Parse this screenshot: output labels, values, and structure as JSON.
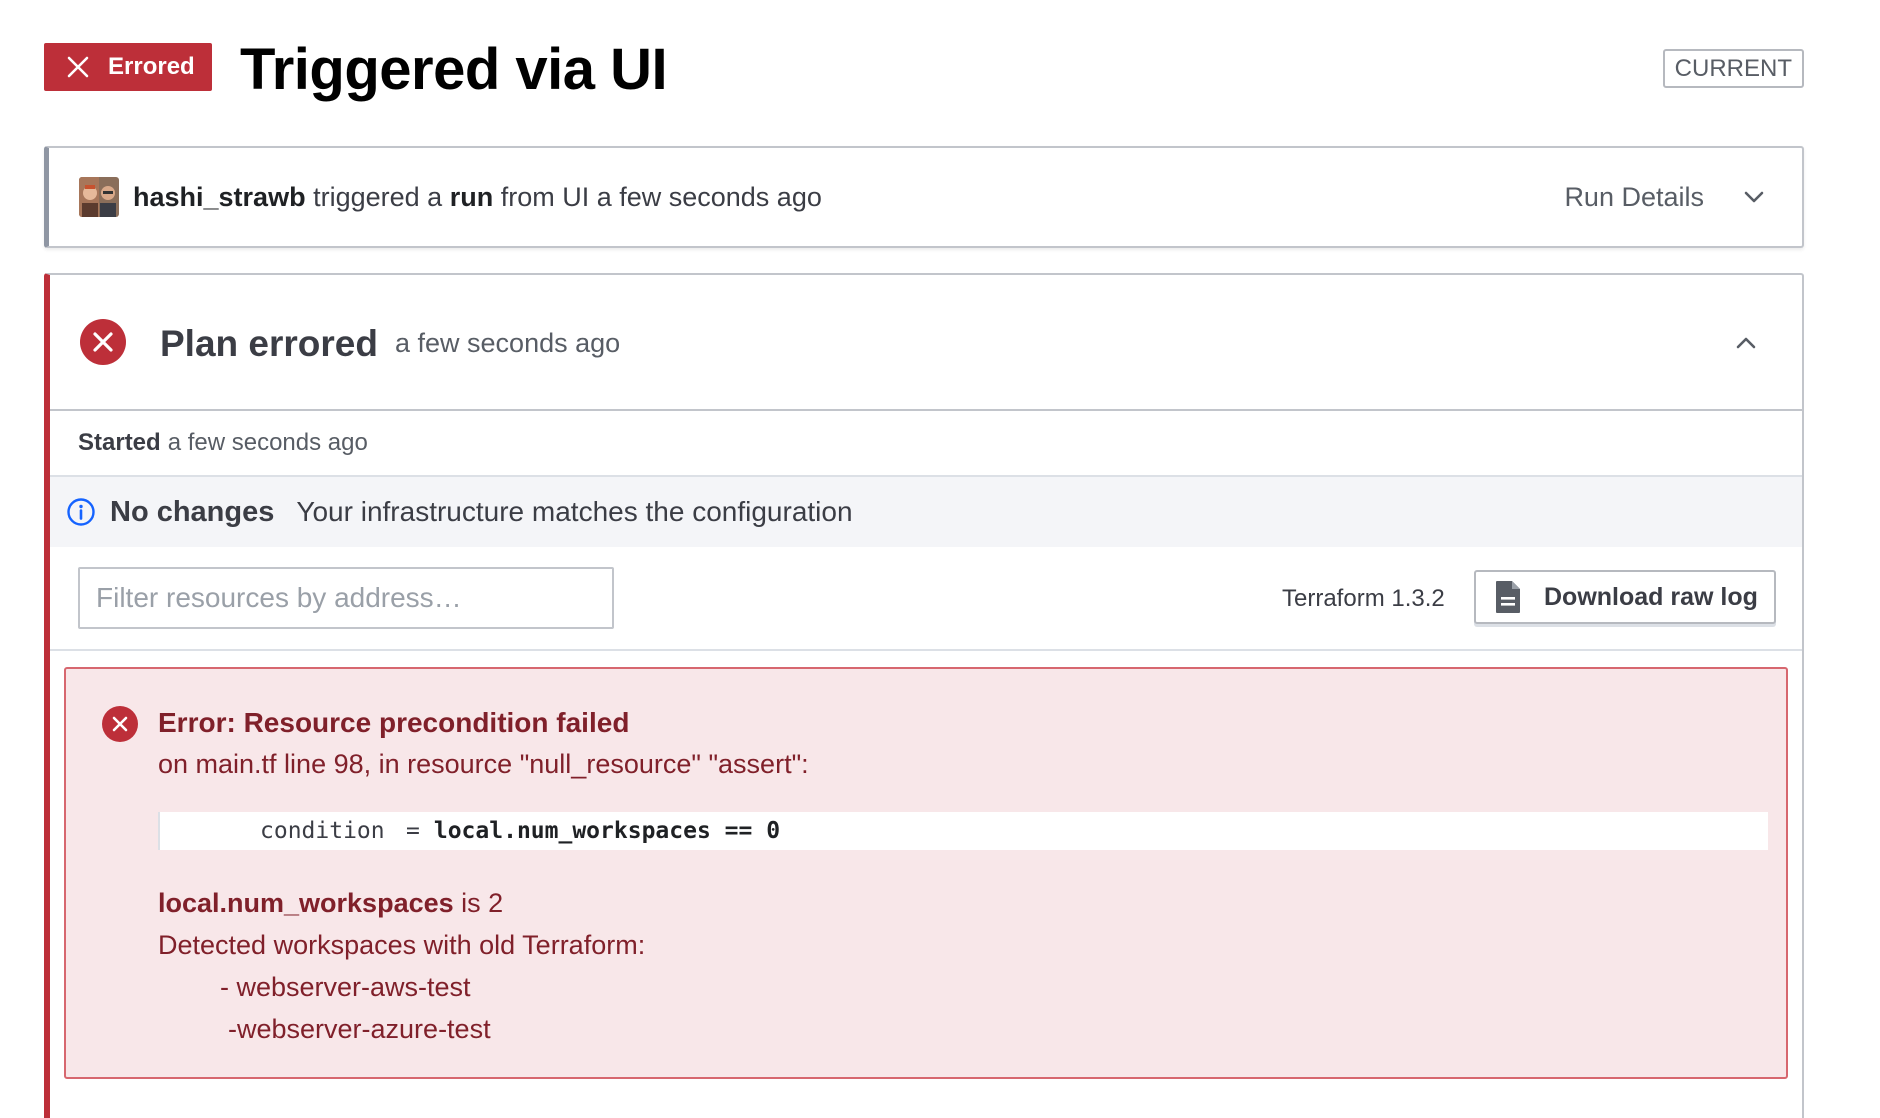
{
  "header": {
    "status_label": "Errored",
    "title": "Triggered via UI",
    "current_badge": "CURRENT"
  },
  "run": {
    "user": "hashi_strawb",
    "text_triggered": "triggered a",
    "text_run": "run",
    "text_from": "from UI a few seconds ago",
    "details_label": "Run Details"
  },
  "plan": {
    "title": "Plan errored",
    "time": "a few seconds ago",
    "started_label": "Started",
    "started_time": "a few seconds ago",
    "no_changes_title": "No changes",
    "no_changes_desc": "Your infrastructure matches the configuration",
    "filter_placeholder": "Filter resources by address…",
    "terraform_version": "Terraform 1.3.2",
    "download_label": "Download raw log"
  },
  "error": {
    "title": "Error: Resource precondition failed",
    "location": "on main.tf line 98, in resource \"null_resource\" \"assert\":",
    "code_key": "condition",
    "code_eq": "=",
    "code_expr": "local.num_workspaces == 0",
    "var_name": "local.num_workspaces",
    "var_value": " is 2",
    "detail_line": "Detected workspaces with old Terraform:",
    "items": [
      "- webserver-aws-test",
      "-webserver-azure-test"
    ]
  },
  "colors": {
    "error_red": "#bd2f39",
    "error_bg": "#f8e7e9",
    "error_text": "#80202a",
    "info_blue": "#1563ff"
  }
}
